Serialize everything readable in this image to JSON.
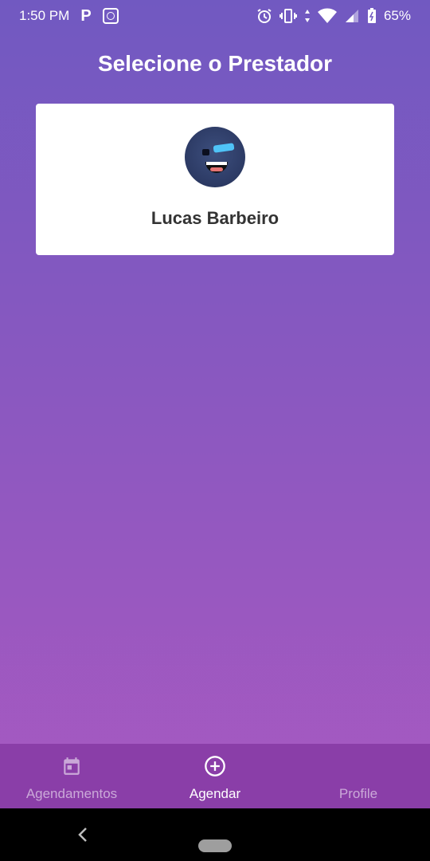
{
  "status_bar": {
    "time": "1:50 PM",
    "battery": "65%",
    "left_icons": [
      "parking-icon",
      "app-notification-icon"
    ],
    "right_icons": [
      "alarm-icon",
      "vibrate-icon",
      "data-arrows-icon",
      "wifi-icon",
      "signal-icon",
      "battery-icon"
    ]
  },
  "header": {
    "title": "Selecione o Prestador"
  },
  "providers": [
    {
      "name": "Lucas Barbeiro",
      "avatar": "avatar-image"
    }
  ],
  "bottom_nav": {
    "tabs": [
      {
        "label": "Agendamentos",
        "icon": "calendar-icon",
        "active": false
      },
      {
        "label": "Agendar",
        "icon": "add-circle-icon",
        "active": true
      },
      {
        "label": "Profile",
        "icon": "",
        "active": false
      }
    ]
  },
  "colors": {
    "gradient_top": "#7159c1",
    "gradient_bottom": "#ab59c1",
    "nav_background": "#8a3ea8",
    "card_background": "#ffffff"
  }
}
